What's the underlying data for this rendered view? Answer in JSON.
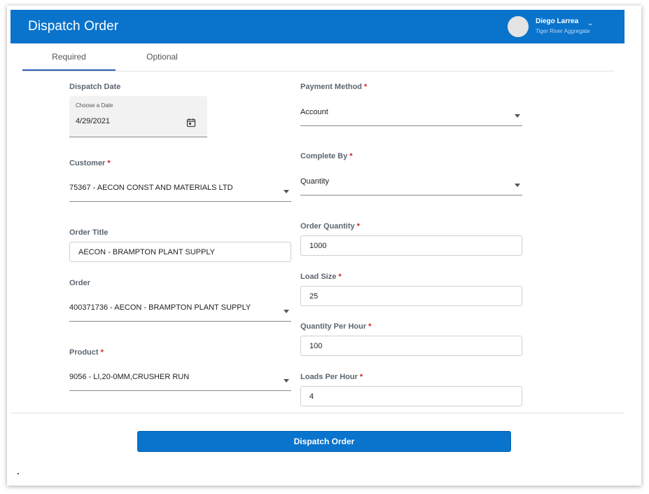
{
  "header": {
    "title": "Dispatch Order",
    "user_name": "Diego Larrea",
    "user_org": "Tiger River Aggregate",
    "chevron": "⌄"
  },
  "tabs": [
    {
      "label": "Required",
      "active": true
    },
    {
      "label": "Optional",
      "active": false
    }
  ],
  "required_marker": "*",
  "form": {
    "dispatch_date": {
      "label": "Dispatch Date",
      "caption": "Choose a Date",
      "value": "4/29/2021",
      "icon": "calendar-icon"
    },
    "customer": {
      "label": "Customer",
      "required": true,
      "value": "75367 - AECON CONST AND MATERIALS LTD"
    },
    "order_title": {
      "label": "Order Title",
      "value": "AECON - BRAMPTON PLANT SUPPLY"
    },
    "order": {
      "label": "Order",
      "value": "400371736 - AECON - BRAMPTON PLANT SUPPLY"
    },
    "product": {
      "label": "Product",
      "required": true,
      "value": "9056 - LI,20-0MM,CRUSHER RUN"
    },
    "payment_method": {
      "label": "Payment Method",
      "required": true,
      "value": "Account"
    },
    "complete_by": {
      "label": "Complete By",
      "required": true,
      "value": "Quantity"
    },
    "order_quantity": {
      "label": "Order Quantity",
      "required": true,
      "value": "1000"
    },
    "load_size": {
      "label": "Load Size",
      "required": true,
      "value": "25"
    },
    "quantity_per_hour": {
      "label": "Quantity Per Hour",
      "required": true,
      "value": "100"
    },
    "loads_per_hour": {
      "label": "Loads Per Hour",
      "required": true,
      "value": "4"
    }
  },
  "footer": {
    "dispatch_button_label": "Dispatch Order"
  },
  "colors": {
    "header_bg": "#0a73cc",
    "button_bg": "#0a73cc",
    "required": "#d21f1f",
    "tab_indicator": "#2b5db5"
  }
}
